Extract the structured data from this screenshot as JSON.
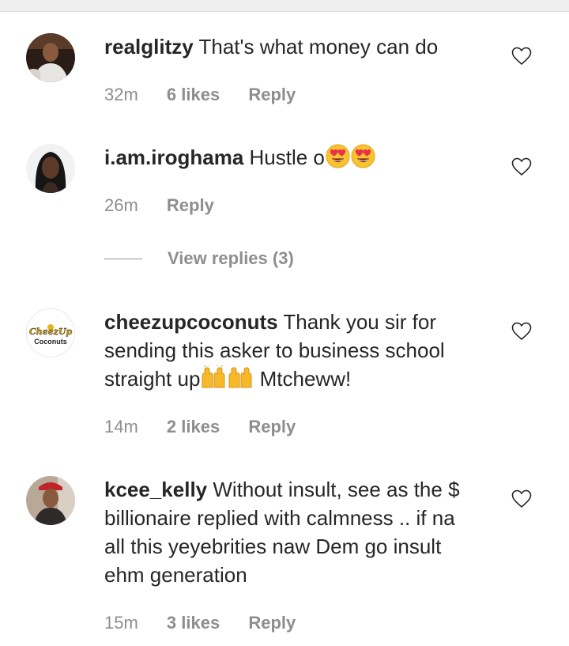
{
  "comments": [
    {
      "username": "realglitzy",
      "text": "That's what money can do",
      "time": "32m",
      "likes": "6 likes",
      "reply": "Reply",
      "avatar_icon": "man-in-white-shirt-avatar"
    },
    {
      "username": "i.am.iroghama",
      "text": "Hustle o",
      "emoji": [
        "heart-eyes-emoji",
        "heart-eyes-emoji"
      ],
      "time": "26m",
      "reply": "Reply",
      "view_replies": "View replies (3)",
      "avatar_icon": "woman-portrait-avatar"
    },
    {
      "username": "cheezupcoconuts",
      "text_line1": "Thank you sir for",
      "text_line2": "sending this asker to business school",
      "text_line3_start": "straight up",
      "text_line3_end": " Mtcheww!",
      "emoji": [
        "raised-hands-emoji",
        "raised-hands-emoji"
      ],
      "time": "14m",
      "likes": "2 likes",
      "reply": "Reply",
      "avatar_logo_top": "CheezUp",
      "avatar_logo_bottom": "Coconuts"
    },
    {
      "username": "kcee_kelly",
      "text_line1": "Without insult, see as the $",
      "text_line2": "billionaire replied with calmness .. if na",
      "text_line3": "all this yeyebrities naw Dem go insult",
      "text_line4": "ehm generation",
      "time": "15m",
      "likes": "3 likes",
      "reply": "Reply",
      "avatar_icon": "person-in-red-cap-avatar"
    }
  ],
  "colors": {
    "text": "#262626",
    "meta": "#8e8e8e",
    "top_bar": "#efefef"
  },
  "icons": {
    "like": "heart-outline-icon"
  }
}
